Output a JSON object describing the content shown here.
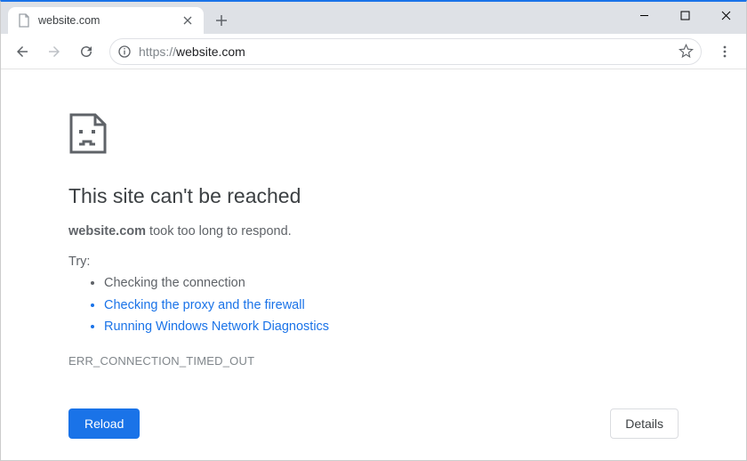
{
  "tab": {
    "title": "website.com"
  },
  "toolbar": {
    "url_scheme": "https://",
    "url_host": "website.com"
  },
  "error": {
    "heading": "This site can't be reached",
    "host_bold": "website.com",
    "message_rest": " took too long to respond.",
    "try_label": "Try:",
    "suggestions": {
      "plain": "Checking the connection",
      "link1": "Checking the proxy and the firewall",
      "link2": "Running Windows Network Diagnostics"
    },
    "code": "ERR_CONNECTION_TIMED_OUT",
    "reload_label": "Reload",
    "details_label": "Details"
  }
}
